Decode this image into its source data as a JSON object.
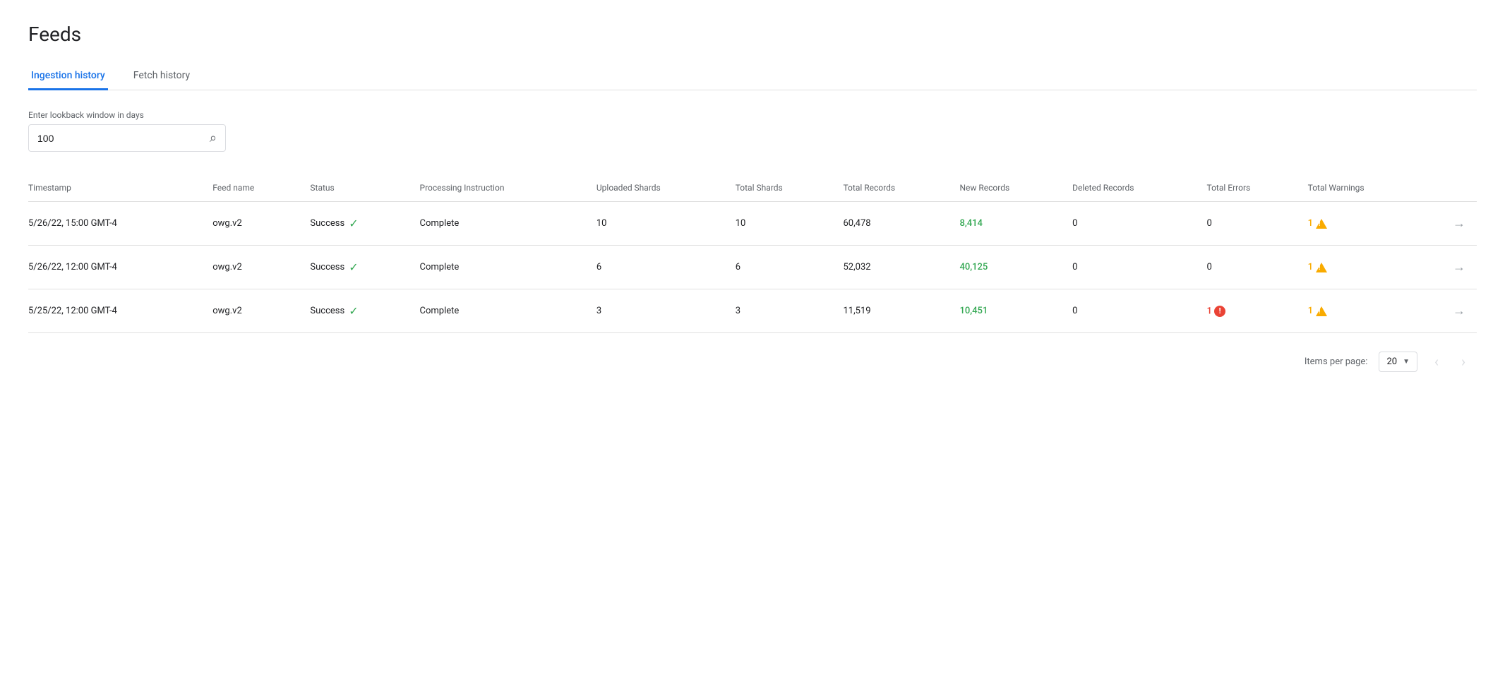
{
  "page": {
    "title": "Feeds"
  },
  "tabs": [
    {
      "id": "ingestion",
      "label": "Ingestion history",
      "active": true
    },
    {
      "id": "fetch",
      "label": "Fetch history",
      "active": false
    }
  ],
  "search": {
    "label": "Enter lookback window in days",
    "value": "100",
    "placeholder": ""
  },
  "table": {
    "columns": [
      {
        "id": "timestamp",
        "label": "Timestamp"
      },
      {
        "id": "feed_name",
        "label": "Feed name"
      },
      {
        "id": "status",
        "label": "Status"
      },
      {
        "id": "processing_instruction",
        "label": "Processing Instruction"
      },
      {
        "id": "uploaded_shards",
        "label": "Uploaded Shards"
      },
      {
        "id": "total_shards",
        "label": "Total Shards"
      },
      {
        "id": "total_records",
        "label": "Total Records"
      },
      {
        "id": "new_records",
        "label": "New Records"
      },
      {
        "id": "deleted_records",
        "label": "Deleted Records"
      },
      {
        "id": "total_errors",
        "label": "Total Errors"
      },
      {
        "id": "total_warnings",
        "label": "Total Warnings"
      }
    ],
    "rows": [
      {
        "timestamp": "5/26/22, 15:00 GMT-4",
        "feed_name": "owg.v2",
        "status": "Success",
        "processing_instruction": "Complete",
        "uploaded_shards": "10",
        "total_shards": "10",
        "total_records": "60,478",
        "new_records": "8,414",
        "deleted_records": "0",
        "total_errors": "0",
        "total_warnings": "1",
        "has_warning": true,
        "has_error": false
      },
      {
        "timestamp": "5/26/22, 12:00 GMT-4",
        "feed_name": "owg.v2",
        "status": "Success",
        "processing_instruction": "Complete",
        "uploaded_shards": "6",
        "total_shards": "6",
        "total_records": "52,032",
        "new_records": "40,125",
        "deleted_records": "0",
        "total_errors": "0",
        "total_warnings": "1",
        "has_warning": true,
        "has_error": false
      },
      {
        "timestamp": "5/25/22, 12:00 GMT-4",
        "feed_name": "owg.v2",
        "status": "Success",
        "processing_instruction": "Complete",
        "uploaded_shards": "3",
        "total_shards": "3",
        "total_records": "11,519",
        "new_records": "10,451",
        "deleted_records": "0",
        "total_errors": "1",
        "total_warnings": "1",
        "has_warning": true,
        "has_error": true
      }
    ]
  },
  "pagination": {
    "items_per_page_label": "Items per page:",
    "items_per_page_value": "20",
    "prev_disabled": true,
    "next_disabled": true
  }
}
